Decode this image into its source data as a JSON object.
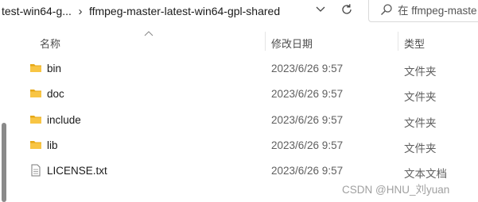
{
  "addressbar": {
    "crumbs": [
      "test-win64-g...",
      "ffmpeg-master-latest-win64-gpl-shared"
    ],
    "separator": "›",
    "search_placeholder": "在 ffmpeg-maste"
  },
  "columns": {
    "name": "名称",
    "date": "修改日期",
    "type": "类型"
  },
  "files": [
    {
      "name": "bin",
      "date": "2023/6/26 9:57",
      "type": "文件夹",
      "icon": "folder-icon"
    },
    {
      "name": "doc",
      "date": "2023/6/26 9:57",
      "type": "文件夹",
      "icon": "folder-icon"
    },
    {
      "name": "include",
      "date": "2023/6/26 9:57",
      "type": "文件夹",
      "icon": "folder-icon"
    },
    {
      "name": "lib",
      "date": "2023/6/26 9:57",
      "type": "文件夹",
      "icon": "folder-icon"
    },
    {
      "name": "LICENSE.txt",
      "date": "2023/6/26 9:57",
      "type": "文本文档",
      "icon": "text-file-icon"
    }
  ],
  "watermark": "CSDN @HNU_刘yuan",
  "colors": {
    "folder": "#f8c544",
    "folder_dark": "#e6a817",
    "scrollbar": "#8a8a8a"
  }
}
